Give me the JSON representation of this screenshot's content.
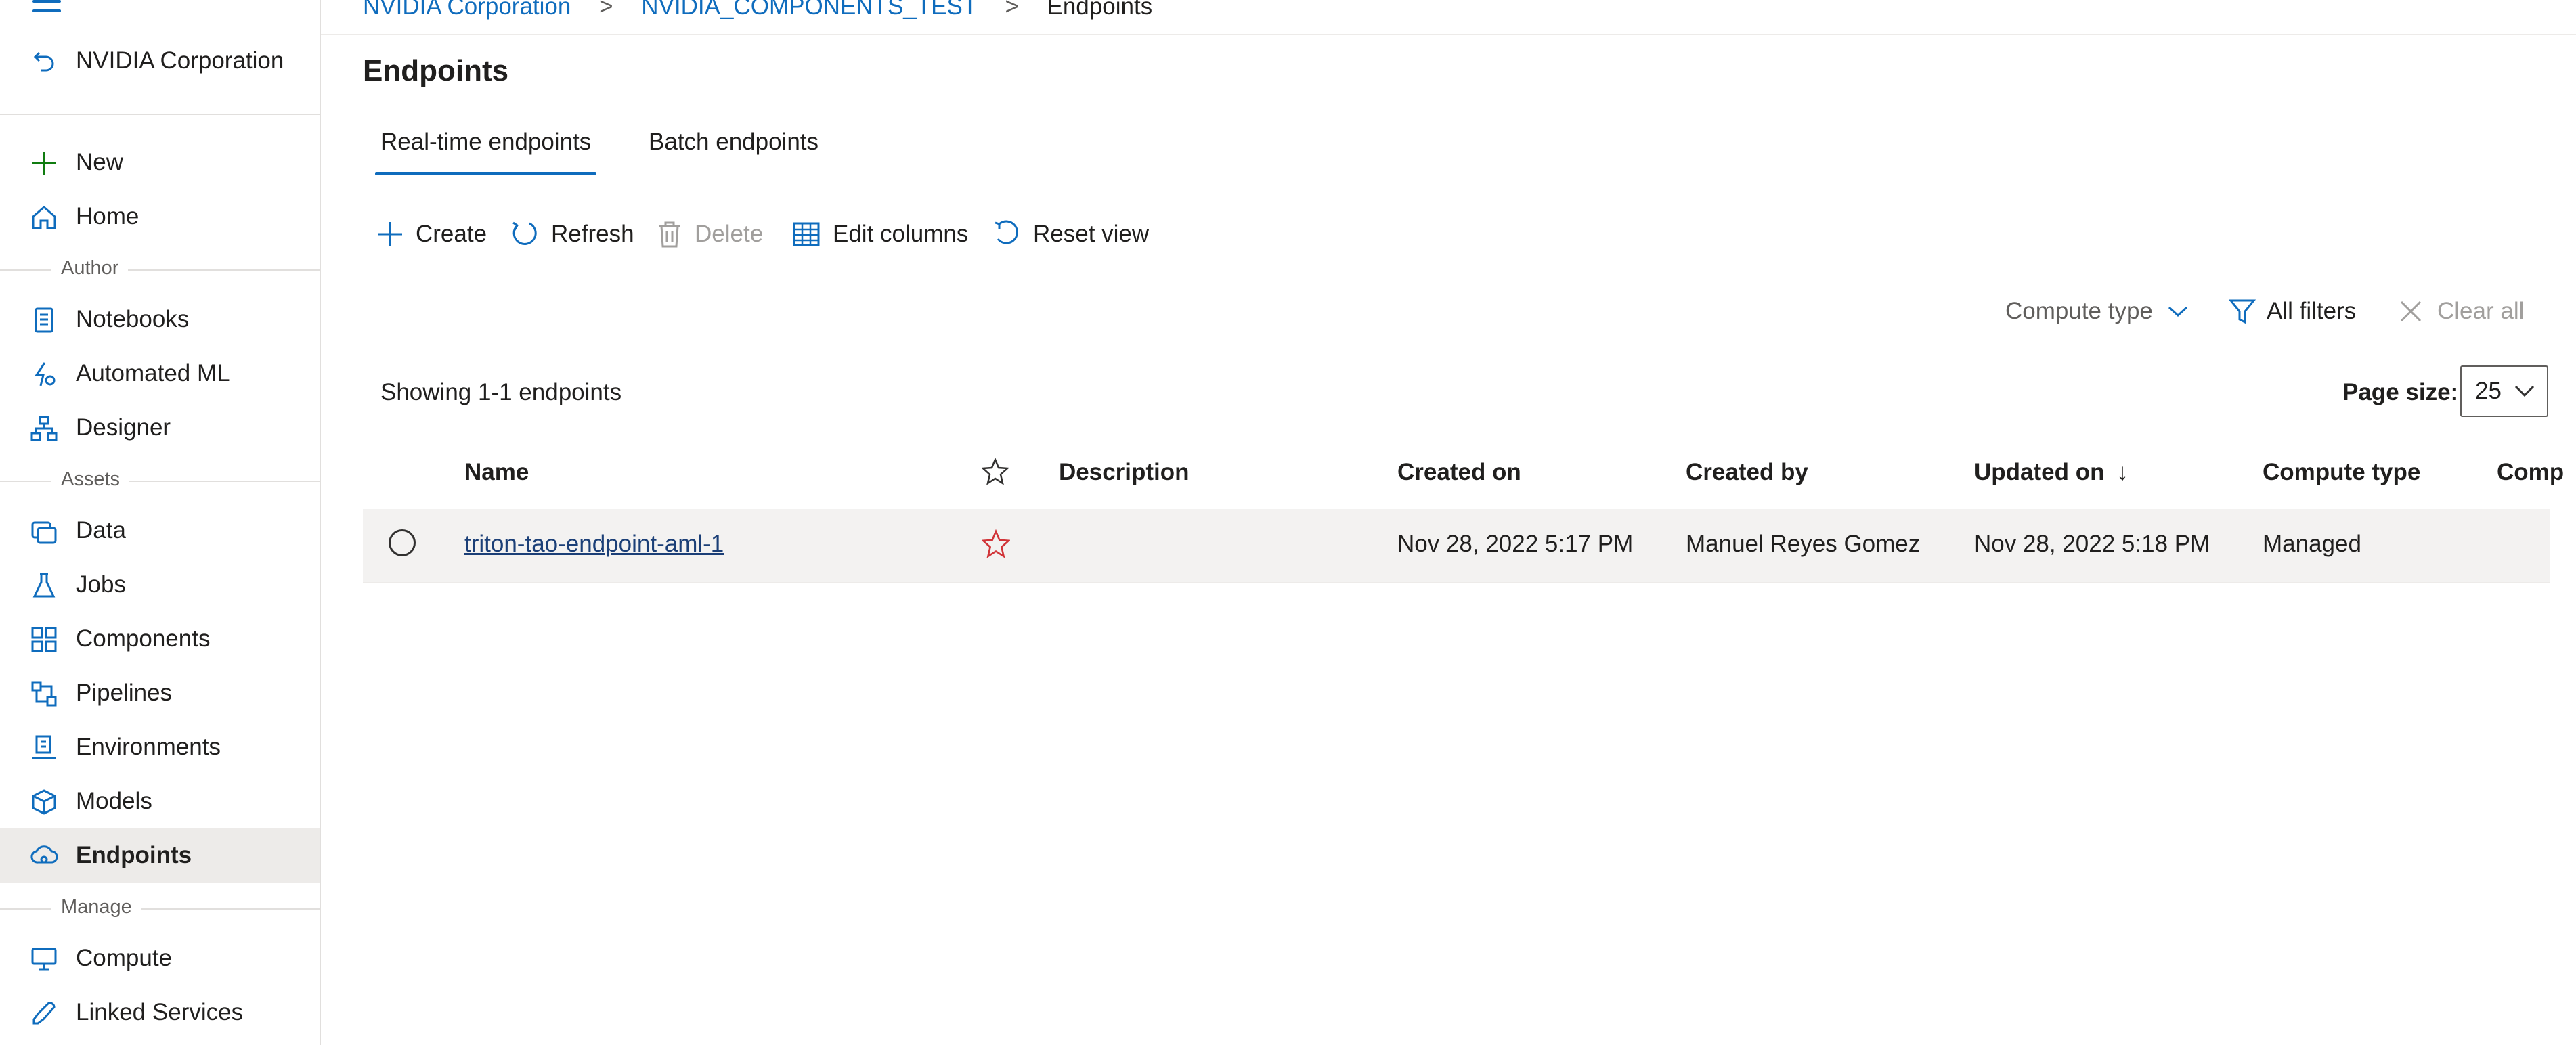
{
  "sidebar": {
    "workspace": "NVIDIA Corporation",
    "items": [
      {
        "label": "New"
      },
      {
        "label": "Home"
      },
      {
        "label": "Notebooks"
      },
      {
        "label": "Automated ML"
      },
      {
        "label": "Designer"
      },
      {
        "label": "Data"
      },
      {
        "label": "Jobs"
      },
      {
        "label": "Components"
      },
      {
        "label": "Pipelines"
      },
      {
        "label": "Environments"
      },
      {
        "label": "Models"
      },
      {
        "label": "Endpoints"
      },
      {
        "label": "Compute"
      },
      {
        "label": "Linked Services"
      }
    ],
    "sections": {
      "author": "Author",
      "assets": "Assets",
      "manage": "Manage"
    },
    "active_item": "Endpoints"
  },
  "breadcrumb": {
    "items": [
      "NVIDIA Corporation",
      "NVIDIA_COMPONENTS_TEST",
      "Endpoints"
    ],
    "separator": ">"
  },
  "page": {
    "title": "Endpoints",
    "tabs": [
      {
        "label": "Real-time endpoints",
        "active": true
      },
      {
        "label": "Batch endpoints",
        "active": false
      }
    ]
  },
  "toolbar": {
    "create": "Create",
    "refresh": "Refresh",
    "delete": "Delete",
    "edit_columns": "Edit columns",
    "reset_view": "Reset view"
  },
  "filters": {
    "compute_type": "Compute type",
    "all_filters": "All filters",
    "clear_all": "Clear all"
  },
  "list": {
    "showing": "Showing 1-1 endpoints",
    "page_size_label": "Page size:",
    "page_size_value": "25"
  },
  "table": {
    "columns": {
      "name": "Name",
      "description": "Description",
      "created_on": "Created on",
      "created_by": "Created by",
      "updated_on": "Updated on",
      "sort_arrow": "↓",
      "compute_type": "Compute type",
      "truncated": "Comp"
    },
    "rows": [
      {
        "name": "triton-tao-endpoint-aml-1",
        "favorite": true,
        "description": "",
        "created_on": "Nov 28, 2022 5:17 PM",
        "created_by": "Manuel Reyes Gomez",
        "updated_on": "Nov 28, 2022 5:18 PM",
        "compute_type": "Managed"
      }
    ]
  },
  "colors": {
    "accent": "#0f6cbd",
    "favorite": "#d13438",
    "active_bg": "#edebe9",
    "row_bg": "#f3f2f1"
  }
}
